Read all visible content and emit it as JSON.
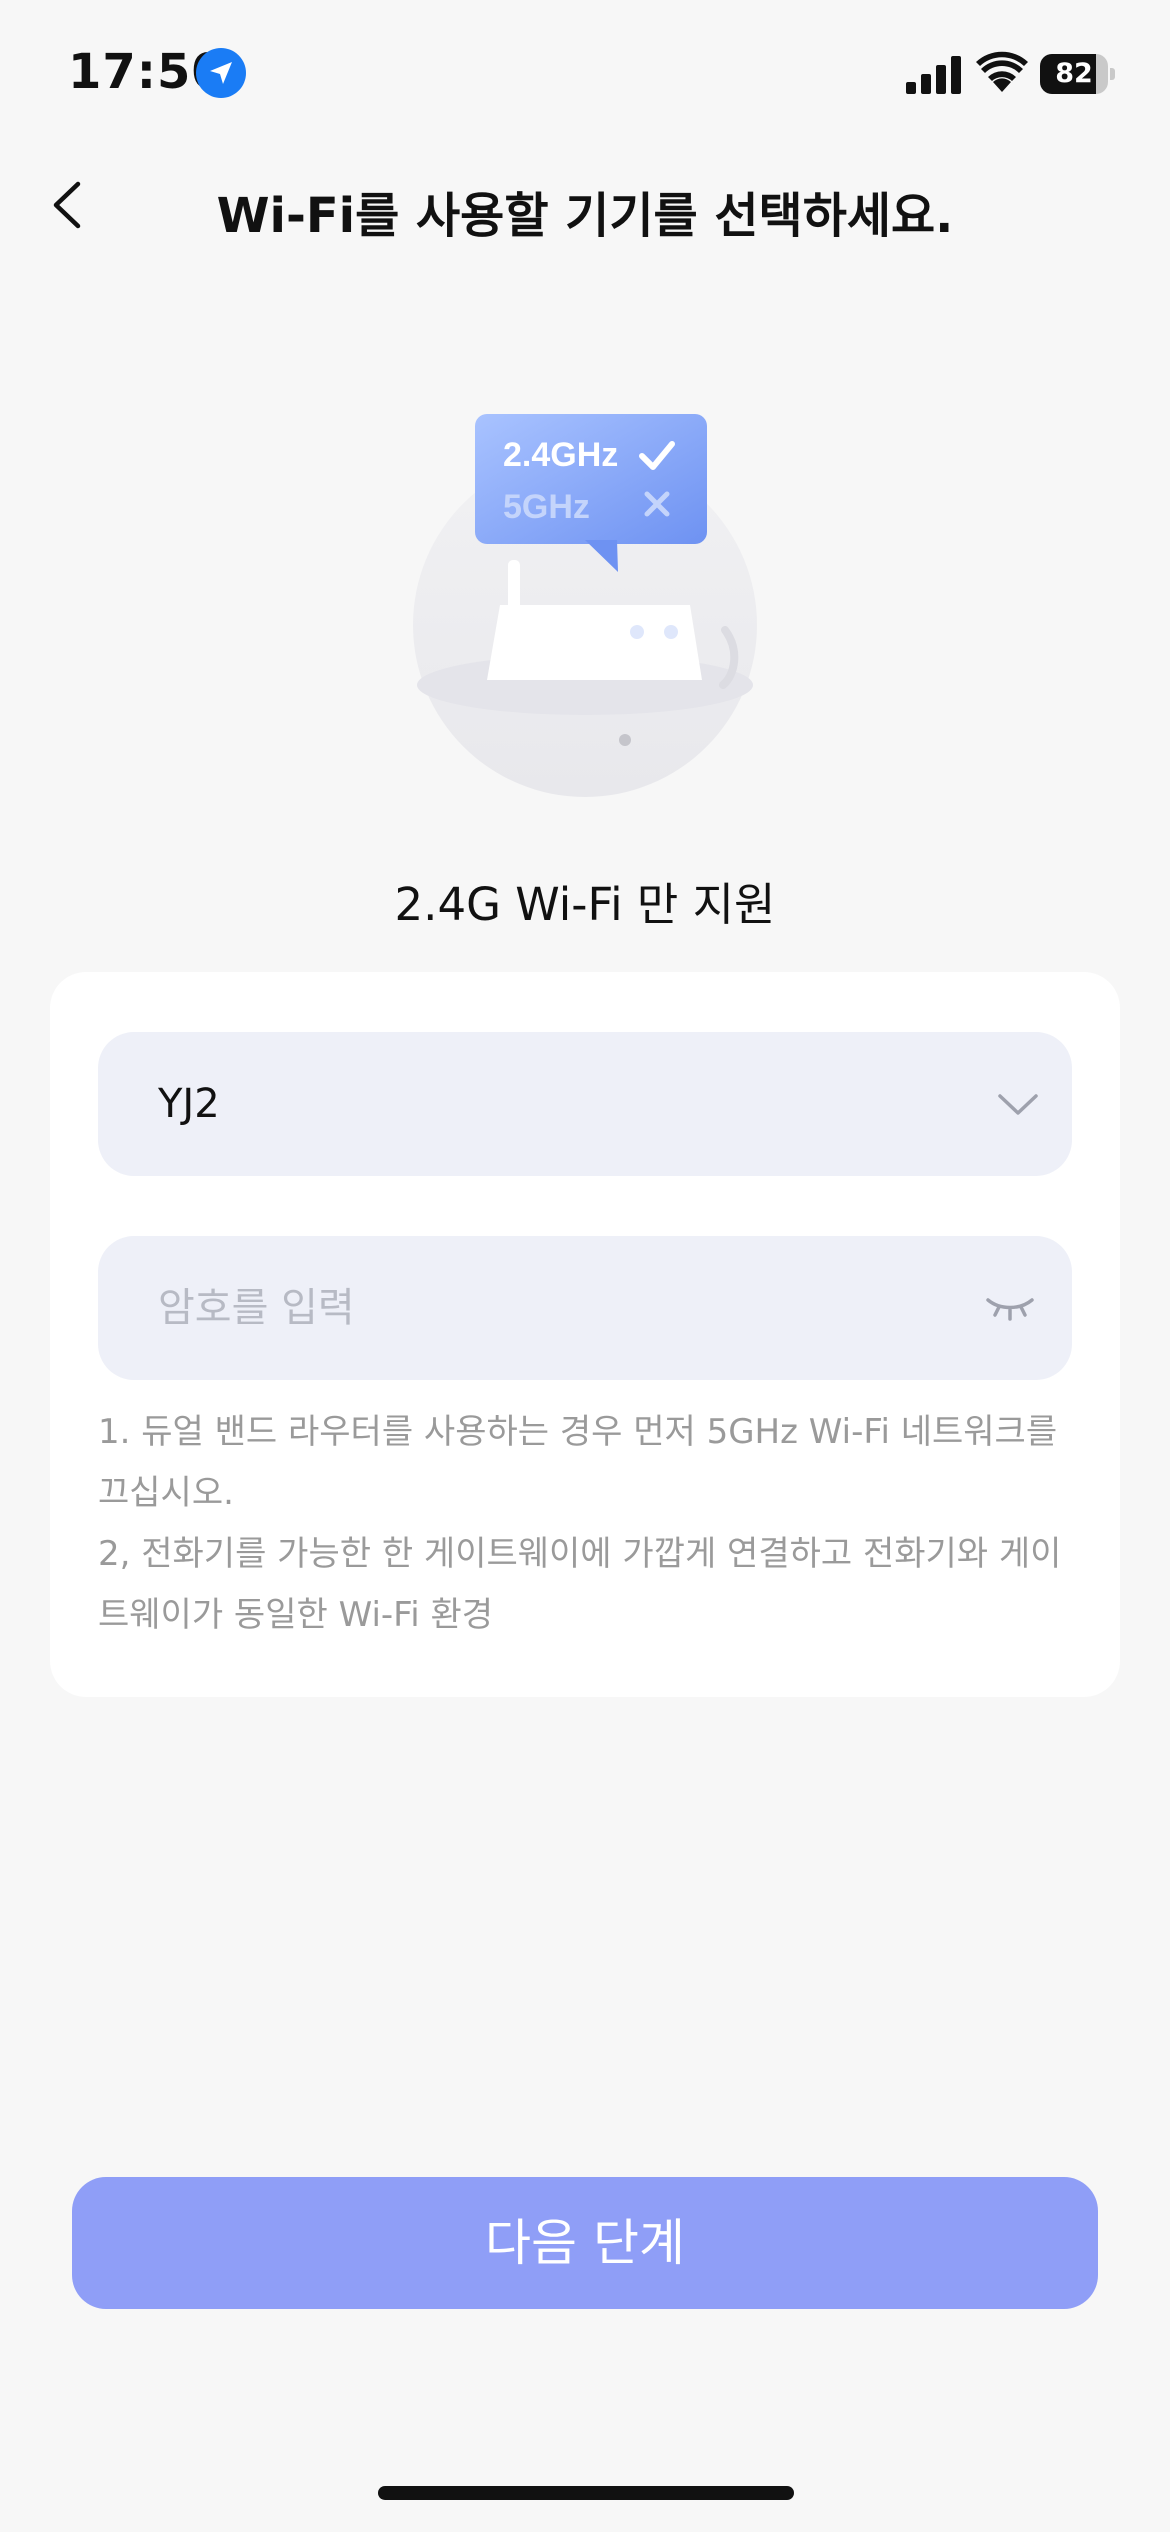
{
  "status_bar": {
    "time": "17:50",
    "battery_level": 82,
    "battery_text": "82"
  },
  "nav": {
    "title": "Wi-Fi를 사용할 기기를 선택하세요."
  },
  "illustration": {
    "band_24": "2.4GHz",
    "band_5": "5GHz"
  },
  "band_note": "2.4G Wi-Fi 만 지원",
  "form": {
    "ssid_value": "YJ2",
    "password_placeholder": "암호를 입력"
  },
  "tips": {
    "line1": "1. 듀얼 밴드 라우터를 사용하는 경우 먼저 5GHz Wi-Fi 네트워크를 끄십시오.",
    "line2": "2, 전화기를 가능한 한 게이트웨이에 가깝게 연결하고 전화기와 게이트웨이가 동일한 Wi-Fi 환경"
  },
  "next_button": "다음 단계",
  "colors": {
    "accent": "#8f9ef7",
    "field_bg": "#eef0f8",
    "page_bg": "#f7f7f7",
    "location": "#1a7cf5"
  },
  "icons": [
    "location-arrow-icon",
    "signal-icon",
    "wifi-icon",
    "battery-icon",
    "back-chevron-icon",
    "chevron-down-icon",
    "eye-closed-icon",
    "check-icon",
    "cross-icon",
    "router-icon"
  ]
}
